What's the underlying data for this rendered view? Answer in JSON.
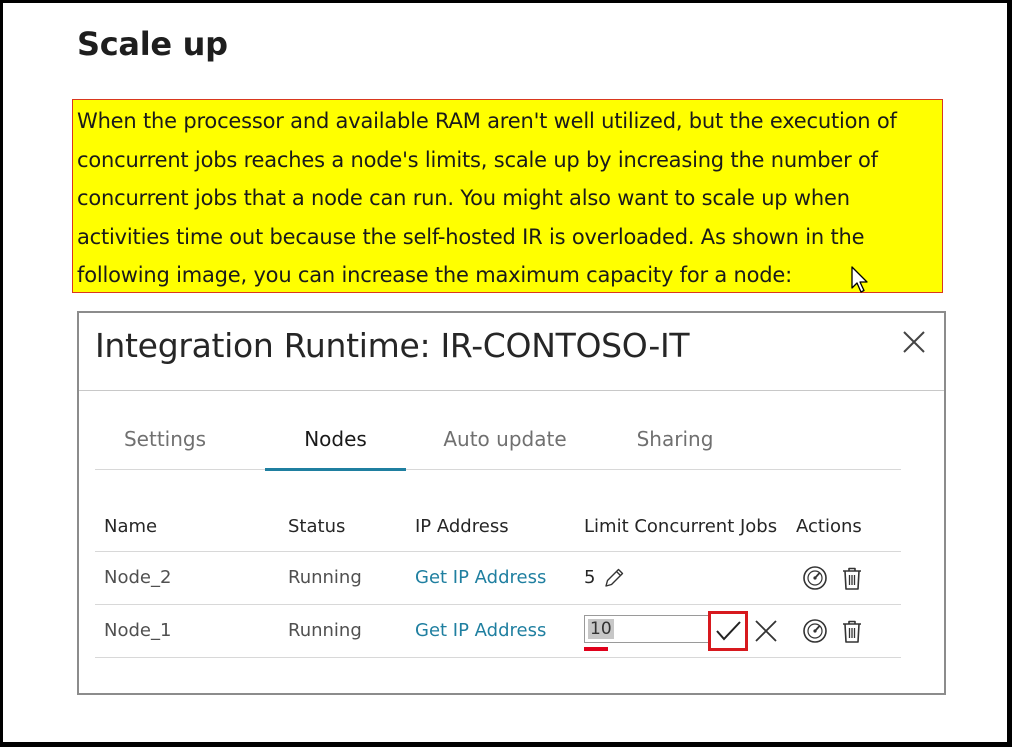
{
  "page": {
    "heading": "Scale up",
    "highlight_text": "When the processor and available RAM aren't well utilized, but the execution of concurrent jobs reaches a node's limits, scale up by increasing the number of concurrent jobs that a node can run. You might also want to scale up when activities time out because the self-hosted IR is overloaded. As shown in the following image, you can increase the maximum capacity for a node:",
    "highlight_lines": [
      "When the processor and available RAM aren't well utilized, but the execution of",
      "concurrent jobs reaches a node's limits, scale up by increasing the number of",
      "concurrent jobs that a node can run. You might also want to scale up when",
      "activities time out because the self-hosted IR is overloaded. As shown in the",
      "following image, you can increase the maximum capacity for a node:"
    ]
  },
  "dialog": {
    "title": "Integration Runtime: IR-CONTOSO-IT",
    "close_icon": "close-icon",
    "tabs": [
      {
        "label": "Settings",
        "active": false
      },
      {
        "label": "Nodes",
        "active": true
      },
      {
        "label": "Auto update",
        "active": false
      },
      {
        "label": "Sharing",
        "active": false
      }
    ],
    "table": {
      "headers": [
        "Name",
        "Status",
        "IP Address",
        "Limit Concurrent Jobs",
        "Actions"
      ],
      "rows": [
        {
          "name": "Node_2",
          "status": "Running",
          "ip": "Get IP Address",
          "limit": "5",
          "editing": false
        },
        {
          "name": "Node_1",
          "status": "Running",
          "ip": "Get IP Address",
          "limit": "10",
          "editing": true
        }
      ],
      "icons": {
        "edit": "pencil-icon",
        "monitor": "gauge-icon",
        "delete": "trash-icon",
        "confirm": "checkmark-icon",
        "cancel": "close-icon"
      }
    }
  },
  "colors": {
    "highlight_bg": "#ffff00",
    "highlight_border": "#d9381e",
    "accent": "#1f7fa0",
    "annotation_red": "#d7191e"
  }
}
